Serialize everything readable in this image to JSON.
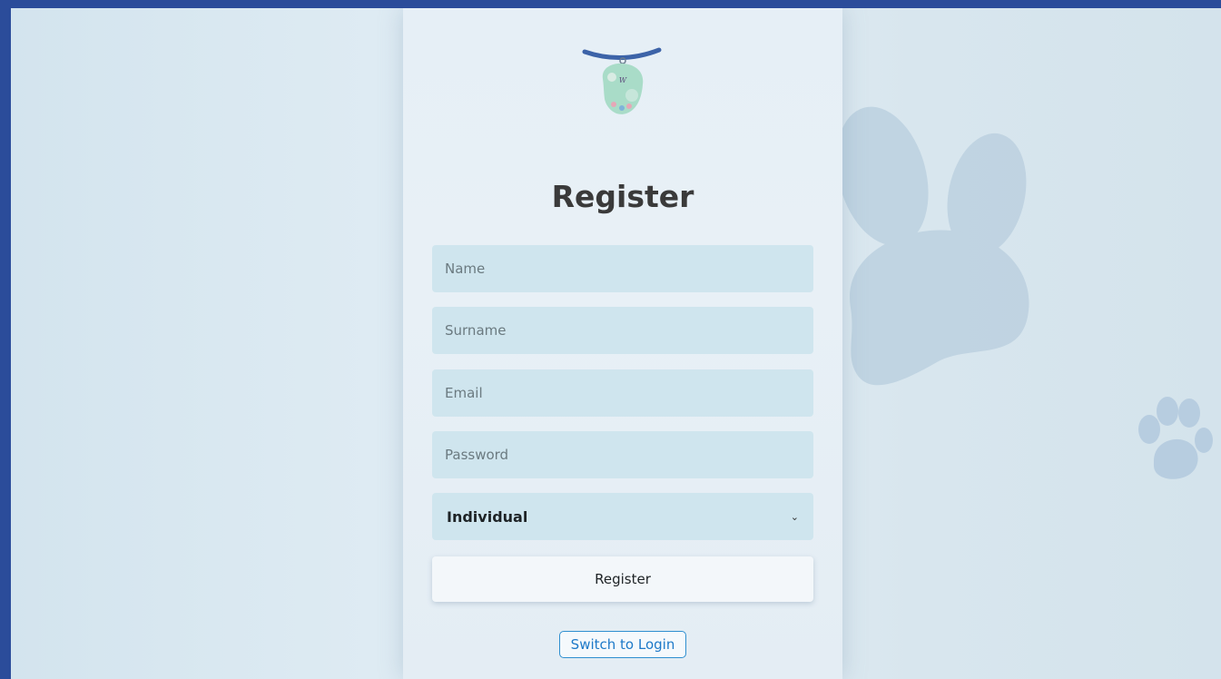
{
  "form": {
    "title": "Register",
    "fields": {
      "name_placeholder": "Name",
      "surname_placeholder": "Surname",
      "email_placeholder": "Email",
      "password_placeholder": "Password"
    },
    "account_type": {
      "selected": "Individual"
    },
    "register_label": "Register",
    "switch_label": "Switch to Login"
  },
  "icons": {
    "logo": "whiskers-logo-icon",
    "background_paw": "paw-print-icon",
    "dropdown": "chevron-down-icon"
  },
  "colors": {
    "frame": "#2b4c9a",
    "input_bg": "#cfe5ee",
    "title": "#3a3a3a",
    "link": "#1d79c8",
    "paw": "#bcd1e0"
  }
}
